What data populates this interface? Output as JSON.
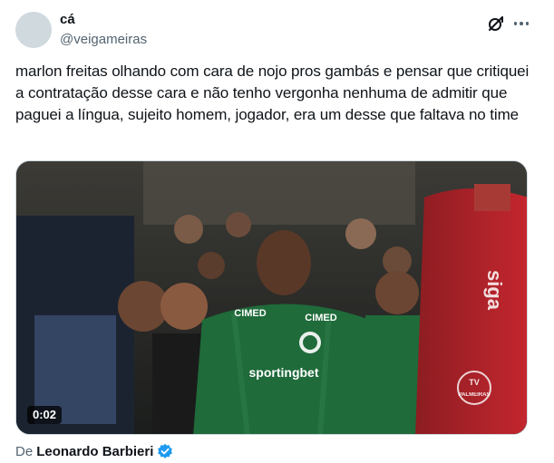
{
  "author": {
    "display_name": "cá",
    "handle": "@veigameiras"
  },
  "icons": {
    "avatar": "default-avatar",
    "grok": "grok-icon",
    "more": "more-options-icon",
    "verified": "verified-badge-icon"
  },
  "tweet": {
    "text": "marlon freitas olhando com cara de nojo pros gambás e pensar que critiquei a contratação desse cara e não tenho vergonha nenhuma de admitir que paguei a língua, sujeito homem, jogador, era um desse que faltava no time"
  },
  "media": {
    "duration": "0:02",
    "jersey_sponsor_chest": "sportingbet",
    "jersey_sponsor_shoulder": "CIMED",
    "channel_logo": "TV PALMEIRAS"
  },
  "attribution": {
    "prefix": "De",
    "source_name": "Leonardo Barbieri"
  },
  "colors": {
    "text_primary": "#0f1419",
    "text_secondary": "#536471",
    "verified_blue": "#1d9bf0",
    "jersey_green": "#1f6b3a"
  }
}
